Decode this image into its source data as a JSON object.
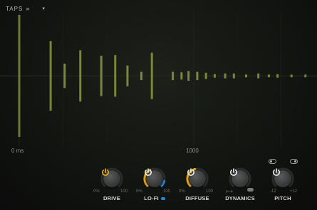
{
  "header": {
    "taps_label": "TAPS",
    "taps_chevrons": "»",
    "dropdown_arrow": "▾"
  },
  "timeline": {
    "start_label": "0 ms",
    "mid_label": "1000"
  },
  "taps": {
    "color": "#8a9a3e",
    "highlight": "#c9c23a",
    "items": [
      {
        "time": 0,
        "level": 1.0
      },
      {
        "time": 180,
        "level": 0.57
      },
      {
        "time": 260,
        "level": 0.2
      },
      {
        "time": 350,
        "level": 0.42
      },
      {
        "time": 470,
        "level": 0.33
      },
      {
        "time": 550,
        "level": 0.34
      },
      {
        "time": 620,
        "level": 0.17
      },
      {
        "time": 700,
        "level": 0.07
      },
      {
        "time": 760,
        "level": 0.38
      },
      {
        "time": 880,
        "level": 0.07
      },
      {
        "time": 930,
        "level": 0.06
      },
      {
        "time": 970,
        "level": 0.08
      },
      {
        "time": 1020,
        "level": 0.07
      },
      {
        "time": 1070,
        "level": 0.05
      },
      {
        "time": 1120,
        "level": 0.03
      },
      {
        "time": 1180,
        "level": 0.04
      },
      {
        "time": 1230,
        "level": 0.04
      },
      {
        "time": 1300,
        "level": 0.02
      },
      {
        "time": 1370,
        "level": 0.04
      },
      {
        "time": 1430,
        "level": 0.02
      },
      {
        "time": 1480,
        "level": 0.03
      },
      {
        "time": 1560,
        "level": 0.02
      },
      {
        "time": 1640,
        "level": 0.01
      },
      {
        "time": 1720,
        "level": 0.01
      },
      {
        "time": 1790,
        "level": 0.02
      },
      {
        "time": 1830,
        "level": 0.02
      }
    ]
  },
  "modules": [
    {
      "id": "drive",
      "name": "DRIVE",
      "min": "0%",
      "max": "100",
      "value": 0.0,
      "arc_color": "#e0a020"
    },
    {
      "id": "lofi",
      "name": "LO-FI",
      "min": "0%",
      "max": "100",
      "value": 0.4,
      "arc_color": "#e0a020",
      "accent": "#2a88d8"
    },
    {
      "id": "diffuse",
      "name": "DIFFUSE",
      "min": "0%",
      "max": "100",
      "value": 0.45,
      "arc_color": "#e6a81c"
    },
    {
      "id": "dynamics",
      "name": "DYNAMICS",
      "value": 0.0
    },
    {
      "id": "pitch",
      "name": "PITCH",
      "min": "-12",
      "max": "+12",
      "value": 0.5
    }
  ]
}
